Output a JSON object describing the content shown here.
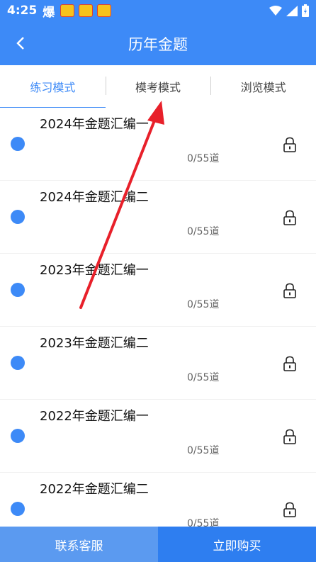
{
  "status": {
    "time": "4:25",
    "extra": "爆"
  },
  "header": {
    "title": "历年金题"
  },
  "tabs": [
    {
      "label": "练习模式",
      "active": true
    },
    {
      "label": "模考模式",
      "active": false
    },
    {
      "label": "浏览模式",
      "active": false
    }
  ],
  "items": [
    {
      "title": "2024年金题汇编一",
      "progress": "0/55道"
    },
    {
      "title": "2024年金题汇编二",
      "progress": "0/55道"
    },
    {
      "title": "2023年金题汇编一",
      "progress": "0/55道"
    },
    {
      "title": "2023年金题汇编二",
      "progress": "0/55道"
    },
    {
      "title": "2022年金题汇编一",
      "progress": "0/55道"
    },
    {
      "title": "2022年金题汇编二",
      "progress": "0/55道"
    }
  ],
  "bottom": {
    "service_label": "联系客服",
    "buy_label": "立即购买"
  },
  "colors": {
    "primary": "#3d8af7",
    "buy": "#2e7ef0",
    "service": "#5b9af0",
    "annotation_arrow": "#e8202a"
  }
}
